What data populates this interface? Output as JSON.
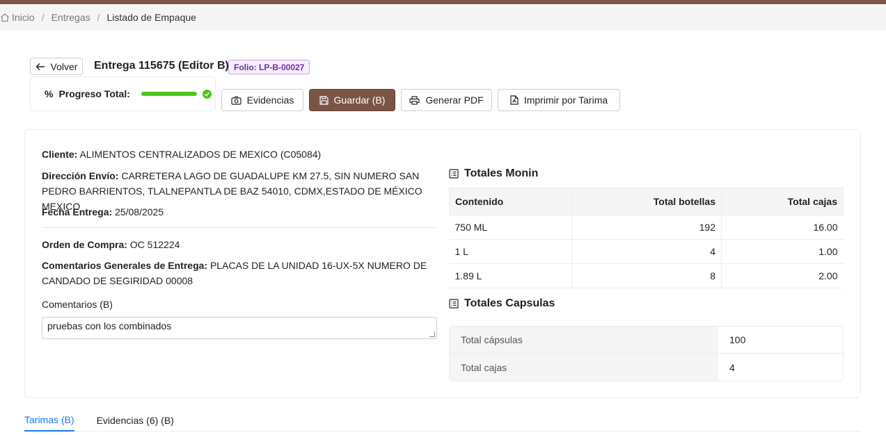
{
  "breadcrumb": {
    "home": "Inicio",
    "entregas": "Entregas",
    "current": "Listado de Empaque"
  },
  "header": {
    "back_label": "Volver",
    "title": "Entrega 115675 (Editor B)",
    "folio": "Folio: LP-B-00027"
  },
  "progress": {
    "icon": "percent-icon",
    "label": "Progreso Total:",
    "value_percent": 100
  },
  "toolbar": {
    "evidencias": "Evidencias",
    "guardar": "Guardar (B)",
    "pdf": "Generar PDF",
    "imprimir": "Imprimir por Tarima"
  },
  "colors": {
    "brand": "#7a5547",
    "progress": "#52c41a",
    "link": "#1677ff",
    "folio": "#6a2fa8"
  },
  "info": {
    "cliente_label": "Cliente:",
    "cliente": "ALIMENTOS CENTRALIZADOS DE MEXICO (C05084)",
    "direccion_label": "Dirección Envío:",
    "direccion": "CARRETERA LAGO DE GUADALUPE KM 27.5, SIN NUMERO SAN PEDRO BARRIENTOS, TLALNEPANTLA DE BAZ 54010, CDMX,ESTADO DE MÉXICO MEXICO",
    "fecha_label": "Fecha Entrega:",
    "fecha": "25/08/2025",
    "orden_label": "Orden de Compra:",
    "orden": "OC 512224",
    "comentarios_gen_label": "Comentarios Generales de Entrega:",
    "comentarios_gen": "PLACAS DE LA UNIDAD 16-UX-5X NUMERO DE CANDADO DE SEGIRIDAD 00008",
    "comentarios_label": "Comentarios (B)",
    "comentarios_value": "pruebas con los combinados"
  },
  "totales_monin": {
    "title": "Totales Monin",
    "headers": [
      "Contenido",
      "Total botellas",
      "Total cajas"
    ],
    "rows": [
      [
        "750 ML",
        "192",
        "16.00"
      ],
      [
        "1 L",
        "4",
        "1.00"
      ],
      [
        "1.89 L",
        "8",
        "2.00"
      ]
    ]
  },
  "totales_capsulas": {
    "title": "Totales Capsulas",
    "rows": [
      [
        "Total cápsulas",
        "100"
      ],
      [
        "Total cajas",
        "4"
      ]
    ]
  },
  "tabs": [
    "Tarimas (B)",
    "Evidencias (6) (B)"
  ]
}
